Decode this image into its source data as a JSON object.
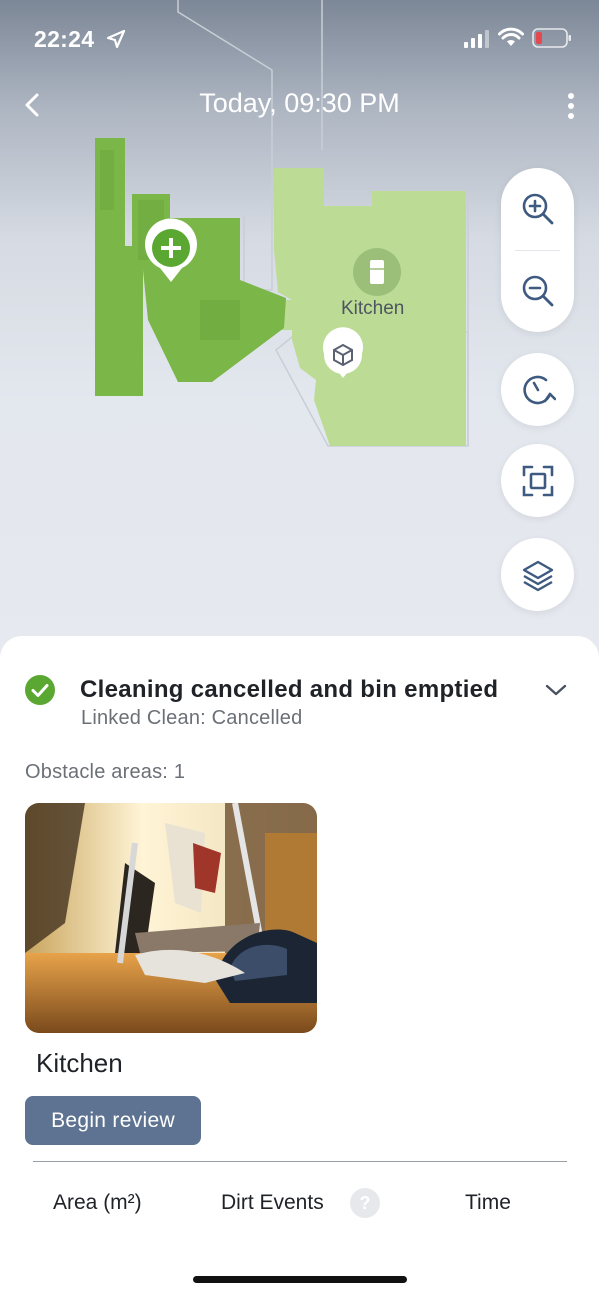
{
  "status_bar": {
    "time": "22:24",
    "icons": [
      "location-arrow-icon",
      "cellular-signal-icon",
      "wifi-icon",
      "battery-low-icon"
    ],
    "battery_color": "#e5484d"
  },
  "nav": {
    "title": "Today, 09:30 PM",
    "back_icon": "chevron-left-icon",
    "more_icon": "vertical-ellipsis-icon"
  },
  "map": {
    "room_label": "Kitchen",
    "markers": [
      "plus-pin-icon",
      "fridge-icon",
      "obstacle-cube-pin-icon"
    ],
    "colors": {
      "cleaned_dark": "#7ab648",
      "cleaned_light": "#bcdc95",
      "outline": "#c9ced6"
    },
    "controls": [
      "zoom-in-icon",
      "zoom-out-icon",
      "rotate-icon",
      "fit-screen-icon",
      "layers-icon"
    ]
  },
  "summary": {
    "status_title": "Cleaning cancelled and bin emptied",
    "status_subtitle": "Linked Clean: Cancelled",
    "status_color": "#5aa832",
    "obstacle_areas_label": "Obstacle areas: 1",
    "obstacle": {
      "room": "Kitchen",
      "review_button": "Begin review"
    },
    "stats": {
      "area_label": "Area (m²)",
      "dirt_label": "Dirt Events",
      "help_glyph": "?",
      "time_label": "Time"
    }
  }
}
